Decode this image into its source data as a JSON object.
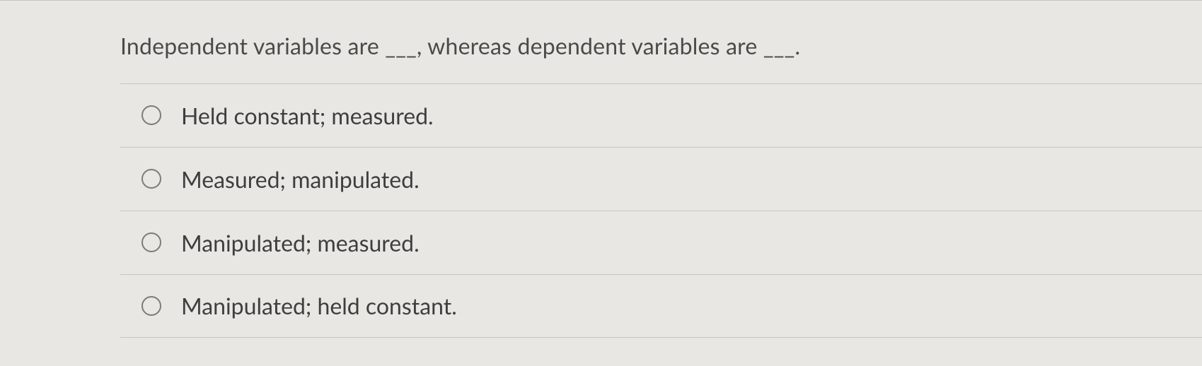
{
  "question": {
    "text": "Independent variables are ___, whereas dependent variables are ___."
  },
  "options": [
    {
      "label": "Held constant; measured."
    },
    {
      "label": "Measured; manipulated."
    },
    {
      "label": "Manipulated; measured."
    },
    {
      "label": "Manipulated; held constant."
    }
  ]
}
